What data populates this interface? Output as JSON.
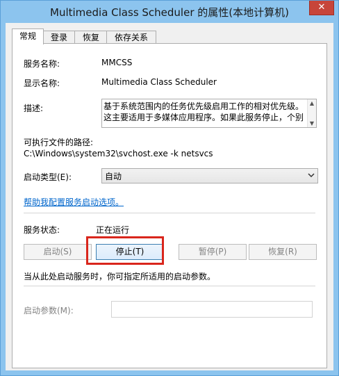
{
  "window": {
    "title": "Multimedia Class Scheduler 的属性(本地计算机)",
    "close_label": "✕"
  },
  "tabs": [
    {
      "label": "常规",
      "active": true
    },
    {
      "label": "登录",
      "active": false
    },
    {
      "label": "恢复",
      "active": false
    },
    {
      "label": "依存关系",
      "active": false
    }
  ],
  "general": {
    "service_name_label": "服务名称:",
    "service_name_value": "MMCSS",
    "display_name_label": "显示名称:",
    "display_name_value": "Multimedia Class Scheduler",
    "description_label": "描述:",
    "description_value": "基于系统范围内的任务优先级启用工作的相对优先级。这主要适用于多媒体应用程序。如果此服务停止，个别",
    "path_label": "可执行文件的路径:",
    "path_value": "C:\\Windows\\system32\\svchost.exe -k netsvcs",
    "startup_type_label": "启动类型(E):",
    "startup_type_value": "自动",
    "help_link": "帮助我配置服务启动选项。",
    "status_label": "服务状态:",
    "status_value": "正在运行",
    "buttons": {
      "start": "启动(S)",
      "stop": "停止(T)",
      "pause": "暂停(P)",
      "resume": "恢复(R)"
    },
    "start_params_hint": "当从此处启动服务时，你可指定所适用的启动参数。",
    "start_params_label": "启动参数(M):",
    "start_params_value": ""
  },
  "colors": {
    "titlebar": "#8cc4ee",
    "close_button": "#c7453a",
    "highlight_box": "#d9261c",
    "link": "#0066cc"
  }
}
